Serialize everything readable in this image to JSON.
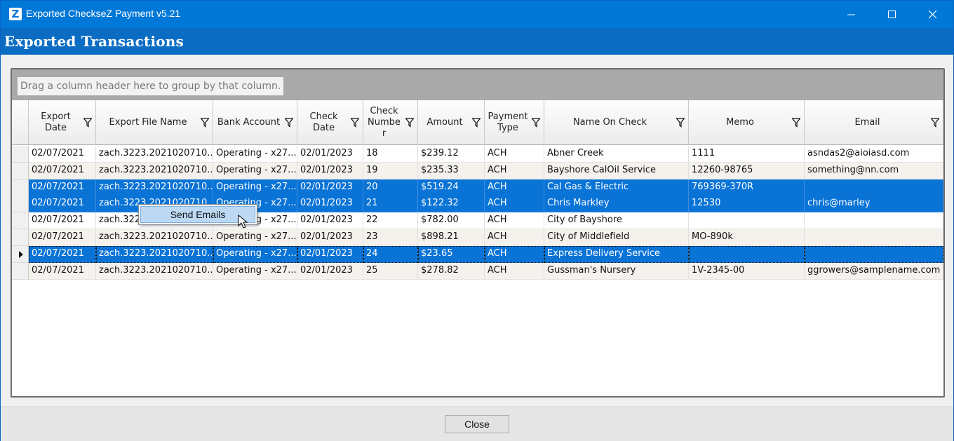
{
  "window": {
    "title": "Exported ChecksеZ Payment v5.21",
    "app_icon_letter": "Z"
  },
  "header": {
    "title": "Exported Transactions"
  },
  "grid": {
    "group_hint": "Drag a column header here to group by that column.",
    "columns": [
      {
        "label": "Export Date"
      },
      {
        "label": "Export File Name"
      },
      {
        "label": "Bank Account"
      },
      {
        "label": "Check\nDate"
      },
      {
        "label": "Check\nNumbe\nr"
      },
      {
        "label": "Amount"
      },
      {
        "label": "Payment\nType"
      },
      {
        "label": "Name On Check"
      },
      {
        "label": "Memo"
      },
      {
        "label": "Email"
      }
    ],
    "rows": [
      {
        "export_date": "02/07/2021",
        "file": "zach.3223.2021020710...",
        "bank": "Operating - x27...",
        "check_date": "02/01/2023",
        "check_no": "18",
        "amount": "$239.12",
        "type": "ACH",
        "name": "Abner Creek",
        "memo": "1111",
        "email": "asndas2@aioiasd.com",
        "selected": false
      },
      {
        "export_date": "02/07/2021",
        "file": "zach.3223.2021020710...",
        "bank": "Operating - x27...",
        "check_date": "02/01/2023",
        "check_no": "19",
        "amount": "$235.33",
        "type": "ACH",
        "name": "Bayshore CalOil Service",
        "memo": "12260-98765",
        "email": "something@nn.com",
        "selected": false
      },
      {
        "export_date": "02/07/2021",
        "file": "zach.3223.2021020710...",
        "bank": "Operating - x27...",
        "check_date": "02/01/2023",
        "check_no": "20",
        "amount": "$519.24",
        "type": "ACH",
        "name": "Cal Gas & Electric",
        "memo": "769369-370R",
        "email": "",
        "selected": true
      },
      {
        "export_date": "02/07/2021",
        "file": "zach.3223.2021020710...",
        "bank": "Operating - x27...",
        "check_date": "02/01/2023",
        "check_no": "21",
        "amount": "$122.32",
        "type": "ACH",
        "name": "Chris Markley",
        "memo": "12530",
        "email": "chris@marley",
        "selected": true
      },
      {
        "export_date": "02/07/2021",
        "file": "zach.3223.2021020710...",
        "bank": "Operating - x27...",
        "check_date": "02/01/2023",
        "check_no": "22",
        "amount": "$782.00",
        "type": "ACH",
        "name": "City of Bayshore",
        "memo": "",
        "email": "",
        "selected": false
      },
      {
        "export_date": "02/07/2021",
        "file": "zach.3223.2021020710...",
        "bank": "Operating - x27...",
        "check_date": "02/01/2023",
        "check_no": "23",
        "amount": "$898.21",
        "type": "ACH",
        "name": "City of Middlefield",
        "memo": "MO-890k",
        "email": "",
        "selected": false
      },
      {
        "export_date": "02/07/2021",
        "file": "zach.3223.2021020710...",
        "bank": "Operating - x27...",
        "check_date": "02/01/2023",
        "check_no": "24",
        "amount": "$23.65",
        "type": "ACH",
        "name": "Express Delivery Service",
        "memo": "",
        "email": "",
        "selected": true,
        "current": true
      },
      {
        "export_date": "02/07/2021",
        "file": "zach.3223.2021020710...",
        "bank": "Operating - x27...",
        "check_date": "02/01/2023",
        "check_no": "25",
        "amount": "$278.82",
        "type": "ACH",
        "name": "Gussman's Nursery",
        "memo": "1V-2345-00",
        "email": "ggrowers@samplename.com",
        "selected": false
      }
    ]
  },
  "context_menu": {
    "item": "Send Emails"
  },
  "footer": {
    "close_label": "Close"
  },
  "colors": {
    "title_bar": "#0078d7",
    "header_band": "#0b6cc4",
    "selection": "#0a73d6"
  }
}
